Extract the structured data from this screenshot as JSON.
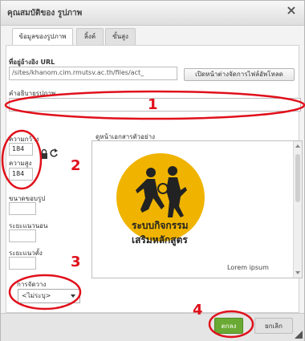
{
  "dialog": {
    "title": "คุณสมบัติของ รูปภาพ",
    "close_icon": "×"
  },
  "tabs": [
    {
      "label": "ข้อมูลของรูปภาพ",
      "active": true
    },
    {
      "label": "ลิ้งค์",
      "active": false
    },
    {
      "label": "ขั้นสูง",
      "active": false
    }
  ],
  "url": {
    "label": "ที่อยู่อ้างอิง URL",
    "value": "/sites/khanom.cim.rmutsv.ac.th/files/act_",
    "browse_button": "เปิดหน้าต่างจัดการไฟล์อัพโหลด"
  },
  "alt": {
    "label": "คำอธิบายรูปภาพ",
    "value": ""
  },
  "size": {
    "width_label": "ความกว้าง",
    "width_value": "184",
    "height_label": "ความสูง",
    "height_value": "184"
  },
  "preview": {
    "label": "ดูหน้าเอกสารตัวอย่าง",
    "logo_line1": "ระบบกิจกรรม",
    "logo_line2": "เสริมหลักสูตร",
    "lorem": "Lorem ipsum"
  },
  "fields": [
    {
      "label": "ขนาดขอบรูป"
    },
    {
      "label": "ระยะแนวนอน"
    },
    {
      "label": "ระยะแนวตั้ง"
    }
  ],
  "align": {
    "label": "การจัดวาง",
    "value": "<ไม่ระบุ>"
  },
  "footer": {
    "ok": "ตกลง",
    "cancel": "ยกเลิก"
  },
  "annotations": {
    "n1": "1",
    "n2": "2",
    "n3": "3",
    "n4": "4",
    "color": "#e0101b"
  },
  "colors": {
    "accent_ok": "#6aa933",
    "logo": "#f0b400"
  }
}
